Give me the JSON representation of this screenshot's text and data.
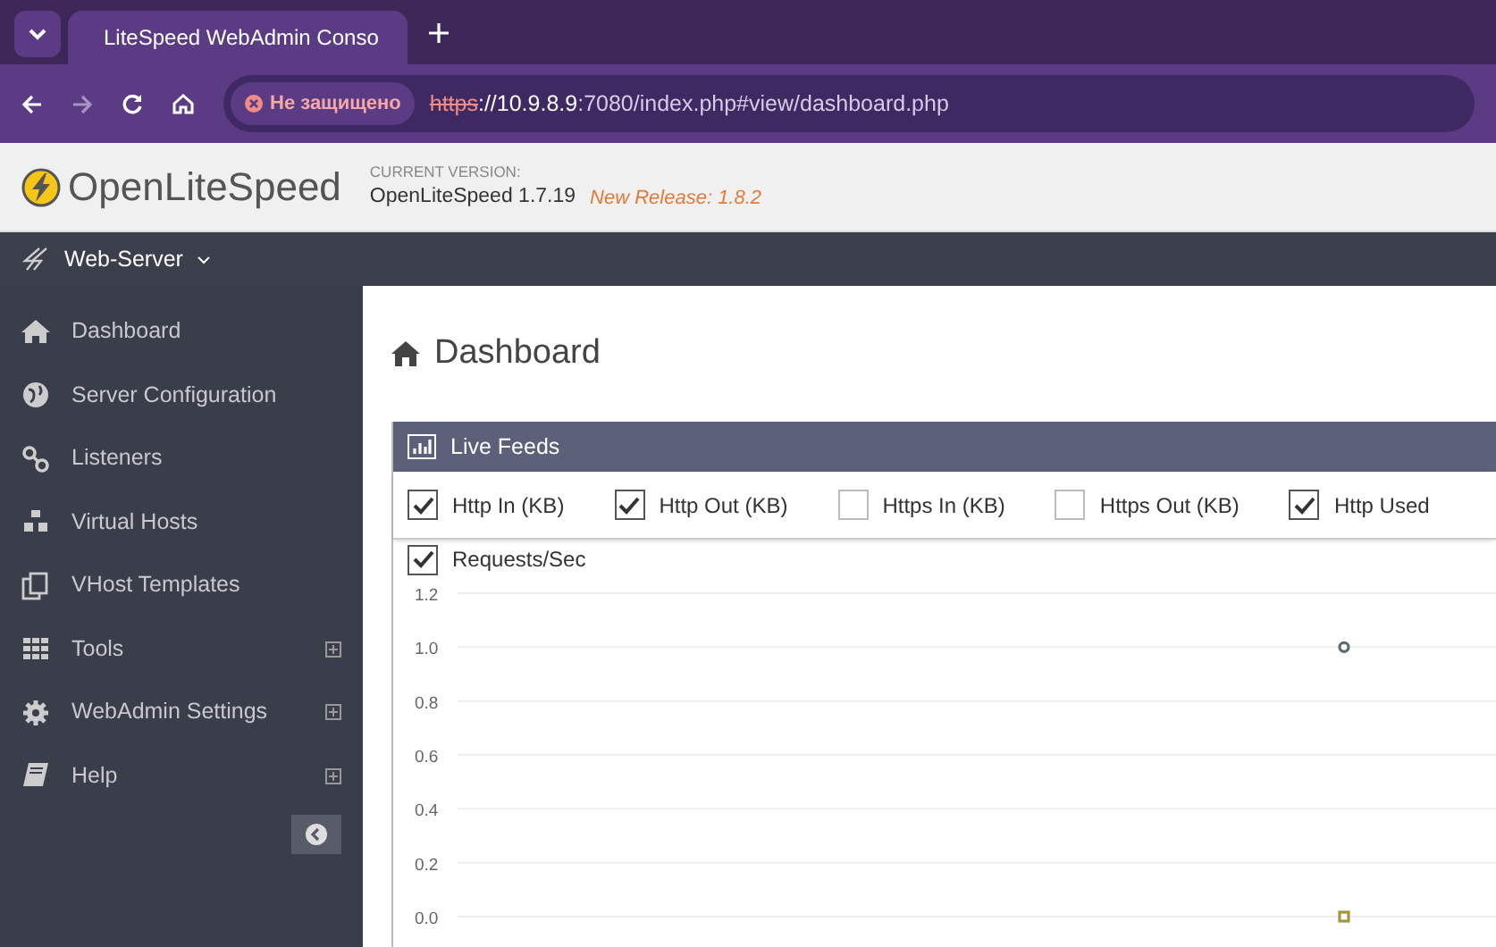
{
  "browser": {
    "tab": {
      "title": "LiteSpeed WebAdmin Conso",
      "selected": true
    },
    "security": "Не защищено",
    "url": {
      "scheme": "https",
      "host": "://10.9.8.9",
      "rest": ":7080/index.php#view/dashboard.php"
    }
  },
  "header": {
    "logo_light": "Open",
    "logo_bold": "LiteSpeed",
    "version_label": "CURRENT VERSION:",
    "version": "OpenLiteSpeed 1.7.19",
    "new_release": "New Release: 1.8.2"
  },
  "topbar": {
    "menu": "Web-Server"
  },
  "sidebar": {
    "items": [
      {
        "label": "Dashboard",
        "expandable": false
      },
      {
        "label": "Server Configuration",
        "expandable": false
      },
      {
        "label": "Listeners",
        "expandable": false
      },
      {
        "label": "Virtual Hosts",
        "expandable": false
      },
      {
        "label": "VHost Templates",
        "expandable": false
      },
      {
        "label": "Tools",
        "expandable": true
      },
      {
        "label": "WebAdmin Settings",
        "expandable": true
      },
      {
        "label": "Help",
        "expandable": true
      }
    ]
  },
  "page_title": "Dashboard",
  "panel": {
    "title": "Live Feeds",
    "feeds": [
      {
        "label": "Http In (KB)",
        "checked": true
      },
      {
        "label": "Http Out (KB)",
        "checked": true
      },
      {
        "label": "Https In (KB)",
        "checked": false
      },
      {
        "label": "Https Out (KB)",
        "checked": false
      },
      {
        "label": "Http Used",
        "checked": true
      },
      {
        "label": "Requests/Sec",
        "checked": true
      }
    ],
    "chart_data": {
      "type": "scatter",
      "grid": true,
      "ylim": [
        0,
        1.2
      ],
      "yticks": [
        {
          "value": 1.2,
          "label": "1.2"
        },
        {
          "value": 1.0,
          "label": "1.0"
        },
        {
          "value": 0.8,
          "label": "0.8"
        },
        {
          "value": 0.6,
          "label": "0.6"
        },
        {
          "value": 0.4,
          "label": "0.4"
        },
        {
          "value": 0.2,
          "label": "0.2"
        },
        {
          "value": 0,
          "label": "0.0"
        }
      ],
      "series": [
        {
          "color": "#5d6b74",
          "values": [
            1.0
          ]
        },
        {
          "color": "#a8963f",
          "values": [
            0.0
          ]
        }
      ]
    }
  }
}
